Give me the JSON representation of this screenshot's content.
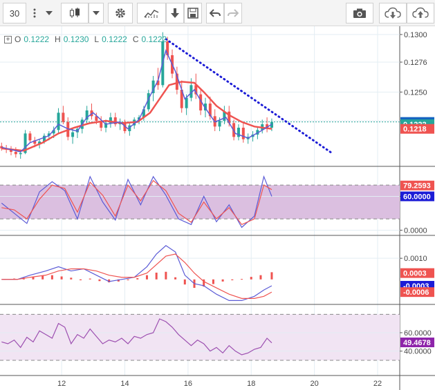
{
  "toolbar": {
    "interval": "30",
    "more_icon": "vertical-dots-icon",
    "dropdown_icon": "caret-down-icon",
    "chart_type_icon": "candlestick-icon",
    "settings_icon": "gear-icon",
    "indicators_icon": "indicators-icon",
    "download_icon": "arrow-down-icon",
    "save_icon": "floppy-disk-icon",
    "undo_icon": "undo-icon",
    "redo_icon": "redo-icon",
    "snapshot_icon": "camera-icon",
    "load_icon": "cloud-download-icon",
    "publish_icon": "cloud-upload-icon"
  },
  "legend": {
    "o_label": "O",
    "o_value": "0.1222",
    "h_label": "H",
    "h_value": "0.1230",
    "l_label": "L",
    "l_value": "0.1222",
    "c_label": "C",
    "c_value": "0.1222"
  },
  "colors": {
    "up": "#26a69a",
    "down": "#ef5350",
    "ma_fast": "#5b5bd6",
    "ma_slow": "#ef5350",
    "trend": "#1c1cd6",
    "osc_fill": "#dbbfe0",
    "rsi_line": "#9c4fb0",
    "grid": "#e3edf3",
    "axis_text": "#444"
  },
  "chart_data": [
    {
      "type": "candlestick",
      "pane": "price",
      "y_ticks": [
        "0.1300",
        "0.1276",
        "0.1250",
        "0.1225"
      ],
      "ylim": [
        0.1186,
        0.1306
      ],
      "price_labels": [
        {
          "value": "0.1224",
          "color": "#1565c0"
        },
        {
          "value": "0.1222",
          "color": "#26a69a"
        },
        {
          "value": "0.1218",
          "color": "#ef5350"
        }
      ],
      "x_ticks": [
        "12",
        "14",
        "16",
        "18",
        "20",
        "22"
      ],
      "x_tick_days": [
        12,
        14,
        16,
        18,
        20,
        22
      ],
      "xlim": [
        10.05,
        22.7
      ],
      "trendline": {
        "from": [
          15.3,
          0.1296
        ],
        "to": [
          20.55,
          0.1197
        ]
      },
      "candles": [
        [
          10.1,
          0.1203,
          0.1206,
          0.1199,
          0.1201
        ],
        [
          10.25,
          0.1201,
          0.1204,
          0.1197,
          0.12
        ],
        [
          10.4,
          0.12,
          0.1203,
          0.1195,
          0.1198
        ],
        [
          10.55,
          0.1198,
          0.1202,
          0.1193,
          0.1196
        ],
        [
          10.7,
          0.1196,
          0.1199,
          0.1192,
          0.1197
        ],
        [
          10.85,
          0.1197,
          0.1217,
          0.1196,
          0.1214
        ],
        [
          11.0,
          0.1214,
          0.1216,
          0.1206,
          0.1208
        ],
        [
          11.15,
          0.1208,
          0.1211,
          0.1202,
          0.1205
        ],
        [
          11.3,
          0.1205,
          0.1209,
          0.1201,
          0.1207
        ],
        [
          11.45,
          0.1207,
          0.1214,
          0.1205,
          0.1212
        ],
        [
          11.6,
          0.1212,
          0.1216,
          0.1208,
          0.1214
        ],
        [
          11.75,
          0.1214,
          0.122,
          0.121,
          0.1217
        ],
        [
          11.9,
          0.1217,
          0.1236,
          0.1214,
          0.1232
        ],
        [
          12.05,
          0.1232,
          0.1238,
          0.1222,
          0.1224
        ],
        [
          12.2,
          0.1224,
          0.1228,
          0.1208,
          0.1211
        ],
        [
          12.35,
          0.1211,
          0.1218,
          0.1205,
          0.1215
        ],
        [
          12.5,
          0.1215,
          0.122,
          0.121,
          0.1218
        ],
        [
          12.65,
          0.1218,
          0.1228,
          0.1214,
          0.1226
        ],
        [
          12.8,
          0.1226,
          0.1238,
          0.1222,
          0.1234
        ],
        [
          12.95,
          0.1234,
          0.124,
          0.1226,
          0.1229
        ],
        [
          13.1,
          0.1229,
          0.1232,
          0.1222,
          0.1225
        ],
        [
          13.25,
          0.1225,
          0.1229,
          0.1216,
          0.1219
        ],
        [
          13.4,
          0.1219,
          0.1226,
          0.1215,
          0.1223
        ],
        [
          13.55,
          0.1223,
          0.1232,
          0.1219,
          0.1228
        ],
        [
          13.7,
          0.1228,
          0.1232,
          0.122,
          0.1222
        ],
        [
          13.85,
          0.1222,
          0.1227,
          0.1217,
          0.1224
        ],
        [
          14.0,
          0.1224,
          0.1226,
          0.1214,
          0.1216
        ],
        [
          14.15,
          0.1216,
          0.1224,
          0.1212,
          0.1221
        ],
        [
          14.3,
          0.1221,
          0.1228,
          0.1218,
          0.1226
        ],
        [
          14.45,
          0.1226,
          0.123,
          0.1222,
          0.1228
        ],
        [
          14.6,
          0.1228,
          0.1238,
          0.1225,
          0.1235
        ],
        [
          14.75,
          0.1235,
          0.1252,
          0.1233,
          0.1249
        ],
        [
          14.9,
          0.1249,
          0.1264,
          0.1242,
          0.126
        ],
        [
          15.05,
          0.126,
          0.1271,
          0.1252,
          0.1256
        ],
        [
          15.2,
          0.1256,
          0.1302,
          0.1254,
          0.1294
        ],
        [
          15.35,
          0.1294,
          0.1298,
          0.1278,
          0.1282
        ],
        [
          15.5,
          0.1282,
          0.1287,
          0.1262,
          0.1266
        ],
        [
          15.65,
          0.1266,
          0.1272,
          0.1248,
          0.1252
        ],
        [
          15.8,
          0.1252,
          0.126,
          0.1232,
          0.1236
        ],
        [
          15.95,
          0.1236,
          0.1248,
          0.123,
          0.1245
        ],
        [
          16.1,
          0.1245,
          0.1262,
          0.1242,
          0.1256
        ],
        [
          16.25,
          0.1256,
          0.1266,
          0.1244,
          0.1248
        ],
        [
          16.4,
          0.1248,
          0.1252,
          0.123,
          0.1234
        ],
        [
          16.55,
          0.1234,
          0.1245,
          0.1228,
          0.124
        ],
        [
          16.7,
          0.124,
          0.1246,
          0.1226,
          0.1229
        ],
        [
          16.85,
          0.1229,
          0.1235,
          0.1216,
          0.122
        ],
        [
          17.0,
          0.122,
          0.1228,
          0.1216,
          0.1225
        ],
        [
          17.15,
          0.1225,
          0.1238,
          0.1222,
          0.1233
        ],
        [
          17.3,
          0.1233,
          0.1238,
          0.122,
          0.1223
        ],
        [
          17.45,
          0.1223,
          0.1226,
          0.1208,
          0.1211
        ],
        [
          17.6,
          0.1211,
          0.1222,
          0.1208,
          0.1219
        ],
        [
          17.75,
          0.1219,
          0.1224,
          0.1206,
          0.1209
        ],
        [
          17.9,
          0.1209,
          0.1214,
          0.1205,
          0.1211
        ],
        [
          18.05,
          0.1211,
          0.1216,
          0.1207,
          0.1213
        ],
        [
          18.2,
          0.1213,
          0.122,
          0.1209,
          0.1217
        ],
        [
          18.35,
          0.1217,
          0.1226,
          0.1214,
          0.1222
        ],
        [
          18.5,
          0.1222,
          0.1228,
          0.1215,
          0.1219
        ],
        [
          18.65,
          0.1219,
          0.1227,
          0.1216,
          0.1224
        ]
      ],
      "ma_fast": [
        [
          10.1,
          0.1202
        ],
        [
          10.7,
          0.1198
        ],
        [
          11.0,
          0.1206
        ],
        [
          11.6,
          0.1212
        ],
        [
          11.9,
          0.1222
        ],
        [
          12.2,
          0.1218
        ],
        [
          12.5,
          0.1216
        ],
        [
          12.8,
          0.1228
        ],
        [
          13.0,
          0.1232
        ],
        [
          13.4,
          0.1222
        ],
        [
          13.85,
          0.1224
        ],
        [
          14.1,
          0.1218
        ],
        [
          14.45,
          0.1226
        ],
        [
          14.75,
          0.1244
        ],
        [
          15.05,
          0.126
        ],
        [
          15.3,
          0.1286
        ],
        [
          15.6,
          0.1268
        ],
        [
          15.9,
          0.1244
        ],
        [
          16.2,
          0.1252
        ],
        [
          16.5,
          0.1238
        ],
        [
          16.85,
          0.1224
        ],
        [
          17.2,
          0.1228
        ],
        [
          17.5,
          0.1214
        ],
        [
          17.9,
          0.121
        ],
        [
          18.3,
          0.1216
        ],
        [
          18.65,
          0.1222
        ]
      ],
      "ma_slow": [
        [
          10.1,
          0.1201
        ],
        [
          10.8,
          0.1199
        ],
        [
          11.4,
          0.1206
        ],
        [
          11.9,
          0.1214
        ],
        [
          12.4,
          0.1219
        ],
        [
          12.9,
          0.1223
        ],
        [
          13.4,
          0.1225
        ],
        [
          13.9,
          0.1223
        ],
        [
          14.4,
          0.1224
        ],
        [
          14.8,
          0.1232
        ],
        [
          15.1,
          0.1244
        ],
        [
          15.4,
          0.1256
        ],
        [
          15.8,
          0.1259
        ],
        [
          16.2,
          0.1258
        ],
        [
          16.5,
          0.125
        ],
        [
          16.9,
          0.1238
        ],
        [
          17.3,
          0.123
        ],
        [
          17.7,
          0.1224
        ],
        [
          18.1,
          0.122
        ],
        [
          18.65,
          0.1218
        ]
      ]
    },
    {
      "type": "line",
      "pane": "stochastic",
      "y_ticks": [
        "60.0000",
        "0.0000"
      ],
      "ylim": [
        -8,
        112
      ],
      "bands": [
        20,
        80
      ],
      "price_labels": [
        {
          "value": "79.2593",
          "color": "#ef5350"
        },
        {
          "value": "60.0000",
          "color": "#1c1cd6"
        }
      ],
      "series": [
        {
          "color": "#5b5bd6",
          "x": [
            10.1,
            10.5,
            10.9,
            11.3,
            11.7,
            12.1,
            12.5,
            12.9,
            13.3,
            13.7,
            14.1,
            14.5,
            14.9,
            15.3,
            15.7,
            16.1,
            16.5,
            16.9,
            17.3,
            17.7,
            18.1,
            18.4,
            18.65
          ],
          "y": [
            48,
            30,
            12,
            68,
            86,
            70,
            20,
            95,
            50,
            18,
            90,
            45,
            95,
            62,
            20,
            10,
            60,
            15,
            45,
            5,
            25,
            95,
            60
          ]
        },
        {
          "color": "#ef5350",
          "x": [
            10.1,
            10.5,
            10.9,
            11.3,
            11.7,
            12.1,
            12.5,
            12.9,
            13.3,
            13.7,
            14.1,
            14.5,
            14.9,
            15.3,
            15.7,
            16.1,
            16.5,
            16.9,
            17.3,
            17.7,
            18.1,
            18.4,
            18.65
          ],
          "y": [
            40,
            36,
            20,
            55,
            80,
            74,
            32,
            85,
            62,
            25,
            80,
            52,
            88,
            70,
            30,
            14,
            50,
            20,
            40,
            10,
            20,
            80,
            72
          ]
        }
      ]
    },
    {
      "type": "bar+line",
      "pane": "macd",
      "y_ticks": [
        "0.0010"
      ],
      "ylim": [
        -0.00115,
        0.00205
      ],
      "price_labels": [
        {
          "value": "0.0003",
          "color": "#ef5350"
        },
        {
          "value": "-0.0003",
          "color": "#1c1cd6"
        },
        {
          "value": "-0.0006",
          "color": "#ef5350"
        }
      ],
      "histogram": [
        [
          10.2,
          2e-05
        ],
        [
          10.5,
          4e-05
        ],
        [
          10.8,
          8e-05
        ],
        [
          11.1,
          0.00012
        ],
        [
          11.4,
          0.00018
        ],
        [
          11.7,
          0.0002
        ],
        [
          12.0,
          0.00014
        ],
        [
          12.3,
          8e-05
        ],
        [
          12.6,
          -4e-05
        ],
        [
          12.9,
          4e-05
        ],
        [
          13.2,
          -8e-05
        ],
        [
          13.5,
          -0.00014
        ],
        [
          13.8,
          -0.0001
        ],
        [
          14.1,
          -4e-05
        ],
        [
          14.4,
          6e-05
        ],
        [
          14.7,
          0.0002
        ],
        [
          15.0,
          0.00032
        ],
        [
          15.3,
          0.00036
        ],
        [
          15.6,
          0.0001
        ],
        [
          15.9,
          -0.00024
        ],
        [
          16.2,
          -0.0004
        ],
        [
          16.5,
          -0.00034
        ],
        [
          16.8,
          -0.00022
        ],
        [
          17.1,
          -0.0001
        ],
        [
          17.4,
          -4e-05
        ],
        [
          17.7,
          2e-05
        ],
        [
          18.0,
          0.00012
        ],
        [
          18.3,
          0.0002
        ],
        [
          18.65,
          0.00034
        ]
      ],
      "series": [
        {
          "color": "#5b5bd6",
          "x": [
            10.1,
            10.6,
            11.0,
            11.5,
            11.9,
            12.3,
            12.7,
            13.1,
            13.5,
            13.9,
            14.3,
            14.7,
            15.0,
            15.3,
            15.6,
            15.9,
            16.2,
            16.5,
            16.9,
            17.3,
            17.7,
            18.1,
            18.4,
            18.65
          ],
          "y": [
            0,
            0,
            0.0002,
            0.0004,
            0.0006,
            0.0004,
            0.0005,
            0.0002,
            -0.0001,
            0,
            0.0001,
            0.0006,
            0.0012,
            0.0016,
            0.0013,
            0.0002,
            -0.0002,
            -0.0003,
            -0.0007,
            -0.001,
            -0.001,
            -0.0008,
            -0.0005,
            -0.0003
          ]
        },
        {
          "color": "#ef5350",
          "x": [
            10.1,
            10.6,
            11.0,
            11.5,
            11.9,
            12.3,
            12.7,
            13.1,
            13.5,
            13.9,
            14.3,
            14.7,
            15.0,
            15.3,
            15.6,
            15.9,
            16.2,
            16.5,
            16.9,
            17.3,
            17.7,
            18.1,
            18.4,
            18.65
          ],
          "y": [
            0,
            0,
            0.0001,
            0.0002,
            0.0004,
            0.0005,
            0.0005,
            0.0004,
            0.0002,
            0.0001,
            0.0001,
            0.0003,
            0.0007,
            0.0011,
            0.0012,
            0.0008,
            0.0003,
            -0.0001,
            -0.0004,
            -0.0007,
            -0.0009,
            -0.0009,
            -0.0008,
            -0.0006
          ]
        }
      ]
    },
    {
      "type": "line",
      "pane": "rsi",
      "y_ticks": [
        "60.0000",
        "40.0000"
      ],
      "ylim": [
        15,
        90
      ],
      "bands": [
        30,
        80
      ],
      "price_labels": [
        {
          "value": "49.4678",
          "color": "#8e24aa"
        }
      ],
      "series": [
        {
          "color": "#9c4fb0",
          "x": [
            10.1,
            10.3,
            10.5,
            10.7,
            10.9,
            11.1,
            11.3,
            11.5,
            11.7,
            11.9,
            12.1,
            12.3,
            12.5,
            12.7,
            12.9,
            13.1,
            13.3,
            13.5,
            13.7,
            13.9,
            14.1,
            14.3,
            14.5,
            14.7,
            14.9,
            15.1,
            15.3,
            15.5,
            15.7,
            15.9,
            16.1,
            16.3,
            16.5,
            16.7,
            16.9,
            17.1,
            17.3,
            17.5,
            17.7,
            17.9,
            18.1,
            18.3,
            18.5,
            18.65
          ],
          "y": [
            50,
            48,
            52,
            44,
            55,
            50,
            62,
            58,
            54,
            70,
            66,
            48,
            58,
            54,
            64,
            56,
            48,
            52,
            50,
            54,
            48,
            56,
            54,
            58,
            60,
            75,
            72,
            66,
            58,
            52,
            46,
            52,
            48,
            40,
            44,
            38,
            46,
            40,
            36,
            38,
            42,
            44,
            54,
            49
          ]
        }
      ]
    }
  ]
}
